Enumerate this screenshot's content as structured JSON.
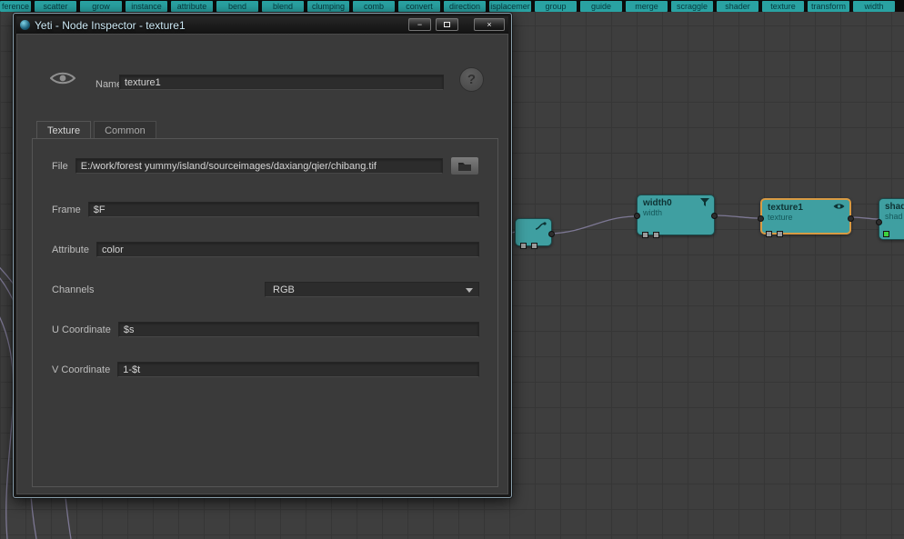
{
  "toolbar": {
    "buttons": [
      "ference",
      "scatter",
      "grow",
      "instance",
      "attribute",
      "bend",
      "blend",
      "clumping",
      "comb",
      "convert",
      "direction",
      "isplacemer",
      "group",
      "guide",
      "merge",
      "scraggle",
      "shader",
      "texture",
      "transform",
      "width"
    ]
  },
  "window": {
    "title": "Yeti - Node Inspector - texture1",
    "minimize_glyph": "−",
    "close_glyph": "×"
  },
  "inspector": {
    "name_label": "Name",
    "name_value": "texture1",
    "help_glyph": "?",
    "tabs": {
      "texture": "Texture",
      "common": "Common"
    },
    "file_label": "File",
    "file_value": "E:/work/forest yummy/island/sourceimages/daxiang/qier/chibang.tif",
    "frame_label": "Frame",
    "frame_value": "$F",
    "attribute_label": "Attribute",
    "attribute_value": "color",
    "channels_label": "Channels",
    "channels_value": "RGB",
    "u_label": "U Coordinate",
    "u_value": "$s",
    "v_label": "V Coordinate",
    "v_value": "1-$t"
  },
  "graph": {
    "nodes": {
      "width0": {
        "title": "width0",
        "subtitle": "width"
      },
      "texture1": {
        "title": "texture1",
        "subtitle": "texture"
      },
      "shader": {
        "title": "shad",
        "subtitle": "shad"
      }
    }
  },
  "colors": {
    "toolbar_teal": "#29a2a2",
    "node_teal": "#3f9fa1",
    "selection_orange": "#d89a43",
    "wire": "#7d7894",
    "port_green": "#3ed23e"
  }
}
